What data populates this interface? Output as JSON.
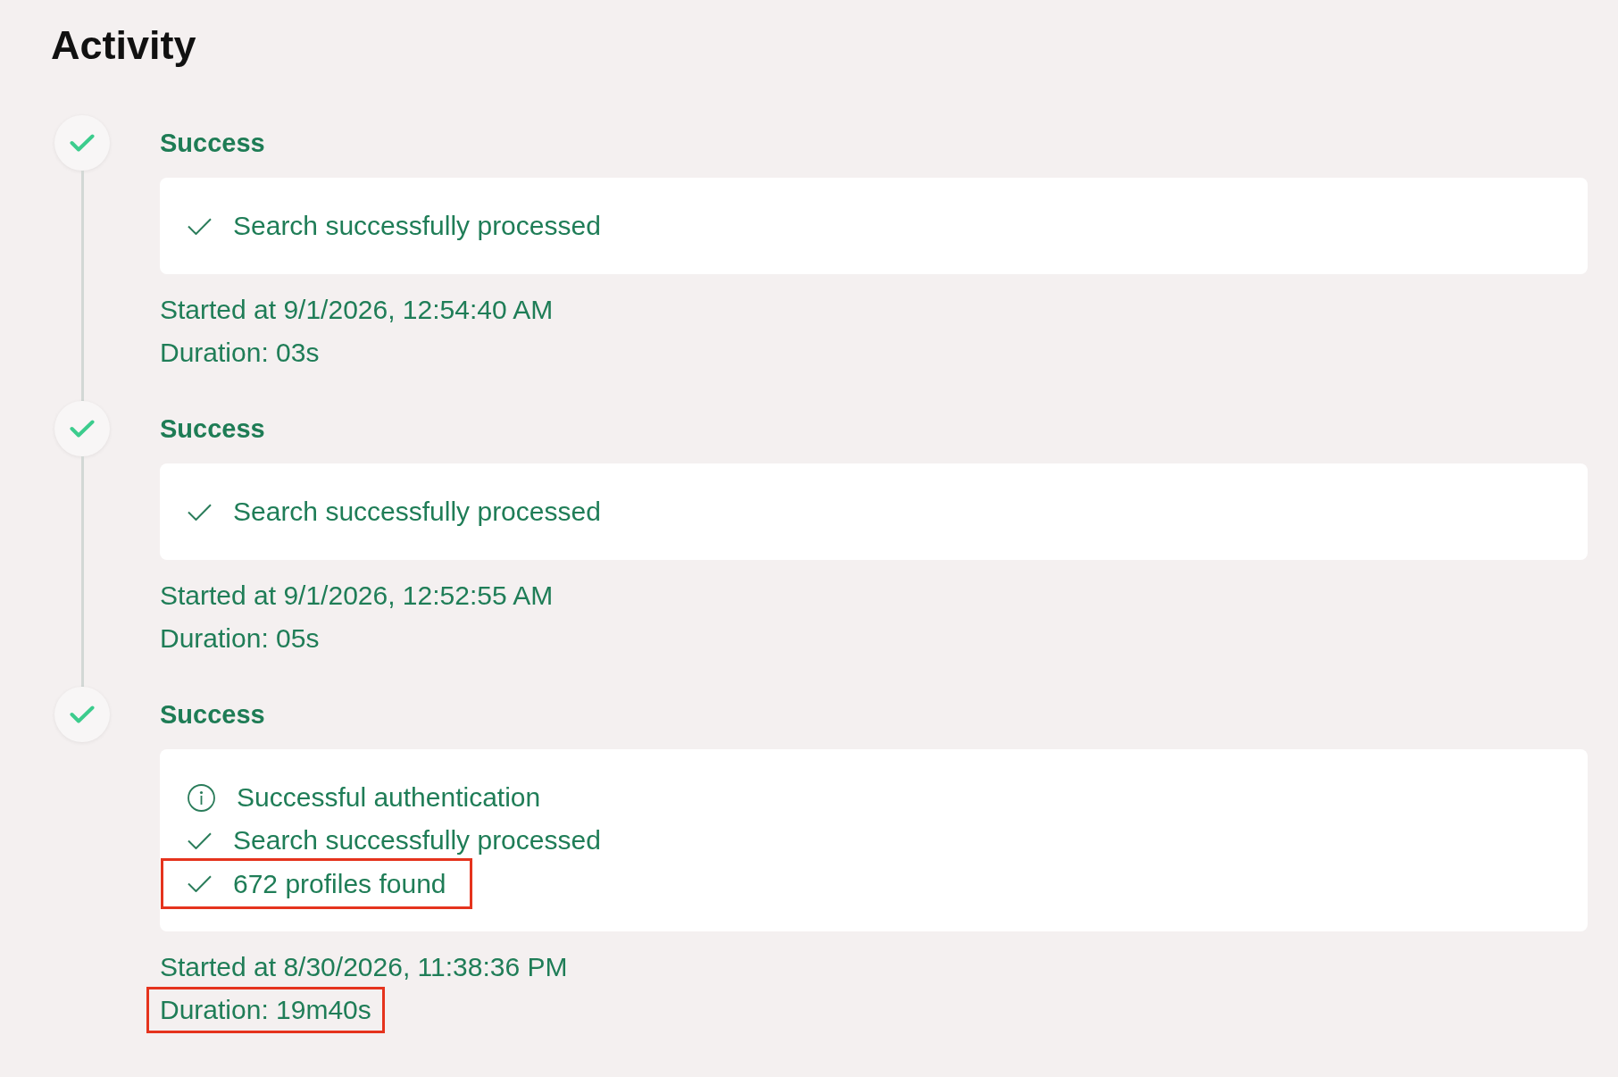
{
  "title": "Activity",
  "entries": [
    {
      "status": "Success",
      "messages": [
        {
          "kind": "check",
          "text": "Search successfully processed",
          "highlighted": false
        }
      ],
      "started": "Started at 9/1/2026, 12:54:40 AM",
      "duration": {
        "text": "Duration: 03s",
        "highlighted": false
      }
    },
    {
      "status": "Success",
      "messages": [
        {
          "kind": "check",
          "text": "Search successfully processed",
          "highlighted": false
        }
      ],
      "started": "Started at 9/1/2026, 12:52:55 AM",
      "duration": {
        "text": "Duration: 05s",
        "highlighted": false
      }
    },
    {
      "status": "Success",
      "messages": [
        {
          "kind": "info",
          "text": "Successful authentication",
          "highlighted": false
        },
        {
          "kind": "check",
          "text": "Search successfully processed",
          "highlighted": false
        },
        {
          "kind": "check",
          "text": "672 profiles found",
          "highlighted": true
        }
      ],
      "started": "Started at 8/30/2026, 11:38:36 PM",
      "duration": {
        "text": "Duration: 19m40s",
        "highlighted": true
      }
    }
  ]
}
